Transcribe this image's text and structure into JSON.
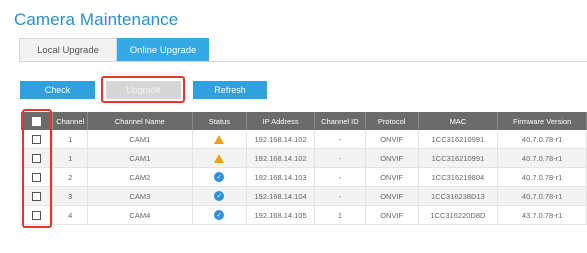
{
  "page": {
    "title": "Camera Maintenance"
  },
  "tabs": [
    {
      "label": "Local Upgrade",
      "active": false
    },
    {
      "label": "Online Upgrade",
      "active": true
    }
  ],
  "toolbar": {
    "check_label": "Check",
    "upgrade_label": "Upgrade",
    "refresh_label": "Refresh"
  },
  "table": {
    "columns": [
      "",
      "Channel",
      "Channel Name",
      "Status",
      "IP Address",
      "Channel ID",
      "Protocol",
      "MAC",
      "Firmware Version"
    ],
    "rows": [
      {
        "channel": "1",
        "name": "CAM1",
        "status": "warning-icon",
        "ip": "192.168.14.102",
        "channel_id": "-",
        "protocol": "ONVIF",
        "mac": "1CC316210991",
        "firmware": "40.7.0.78-r1"
      },
      {
        "channel": "1",
        "name": "CAM1",
        "status": "warning-icon",
        "ip": "192.168.14.102",
        "channel_id": "-",
        "protocol": "ONVIF",
        "mac": "1CC316210991",
        "firmware": "40.7.0.78-r1"
      },
      {
        "channel": "2",
        "name": "CAM2",
        "status": "check-circle-icon",
        "ip": "192.168.14.103",
        "channel_id": "-",
        "protocol": "ONVIF",
        "mac": "1CC316219804",
        "firmware": "40.7.0.78-r1"
      },
      {
        "channel": "3",
        "name": "CAM3",
        "status": "check-circle-icon",
        "ip": "192.168.14.104",
        "channel_id": "-",
        "protocol": "ONVIF",
        "mac": "1CC316238D13",
        "firmware": "40.7.0.78-r1"
      },
      {
        "channel": "4",
        "name": "CAM4",
        "status": "check-circle-icon",
        "ip": "192.168.14.105",
        "channel_id": "1",
        "protocol": "ONVIF",
        "mac": "1CC316220D8D",
        "firmware": "43.7.0.78-r1"
      }
    ]
  },
  "colors": {
    "accent": "#2fa1df",
    "highlight": "#e0382f",
    "warning": "#f0a11a",
    "ok": "#2d8fe0"
  }
}
